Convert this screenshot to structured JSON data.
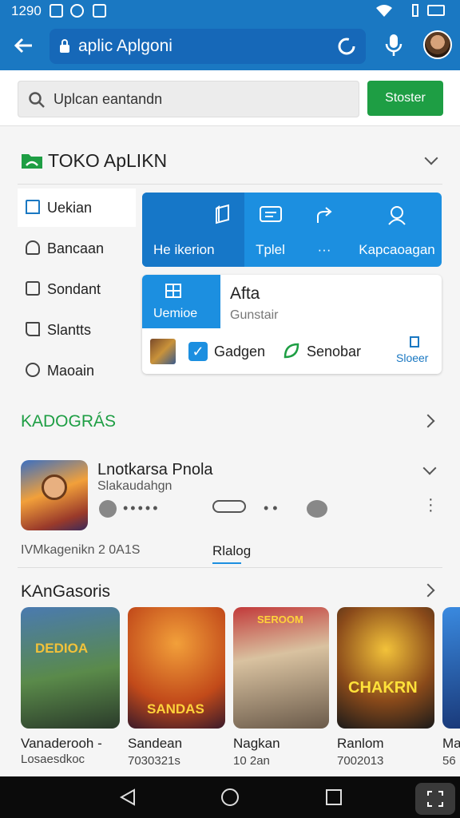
{
  "status": {
    "time": "1290"
  },
  "appbar": {
    "url": "aplic Aplgoni"
  },
  "search": {
    "placeholder": "Uplcan eantandn",
    "button": "Stoster"
  },
  "section1": {
    "title": "TOKO ApLIKN"
  },
  "sidebar": {
    "items": [
      {
        "label": "Uekian",
        "icon": "bookmark-icon"
      },
      {
        "label": "Bancaan",
        "icon": "person-icon"
      },
      {
        "label": "Sondant",
        "icon": "square-icon"
      },
      {
        "label": "Slantts",
        "icon": "bookmark-outline-icon"
      },
      {
        "label": "Maoain",
        "icon": "circle-icon"
      }
    ]
  },
  "tiles": [
    {
      "label": "He ikerion",
      "icon": "book-icon"
    },
    {
      "label": "Tplel",
      "icon": "chat-icon"
    },
    {
      "label": "···",
      "icon": "share-icon"
    },
    {
      "label": "Kapcaoagan",
      "icon": "person-search-icon"
    }
  ],
  "card": {
    "demo_label": "Uemioe",
    "title": "Afta",
    "subtitle": "Gunstair",
    "option1": "Gadgen",
    "option2": "Senobar",
    "action": "Sloeer"
  },
  "section2": {
    "title": "KADOGRÁS"
  },
  "featured": {
    "title": "Lnotkarsa Pnola",
    "subtitle": "Slakaudahgn",
    "meta": "IVMkagenikn 2 0A1S",
    "tab": "Rlalog"
  },
  "section3": {
    "title": "KAnGasoris"
  },
  "games": [
    {
      "name": "Vanaderooh -",
      "sub": "Losaesdkoc",
      "art_text": "DEDIOA"
    },
    {
      "name": "Sandean",
      "sub": "7030321s",
      "art_text": "SANDAS"
    },
    {
      "name": "Nagkan",
      "sub": "10 2an",
      "art_text": "SEROOM"
    },
    {
      "name": "Ranlom",
      "sub": "7002013",
      "art_text": "CHAKRN"
    },
    {
      "name": "Ma",
      "sub": "56",
      "art_text": ""
    }
  ],
  "colors": {
    "primary": "#1a78c2",
    "accent": "#1c8fe0",
    "green": "#1e9e44"
  }
}
